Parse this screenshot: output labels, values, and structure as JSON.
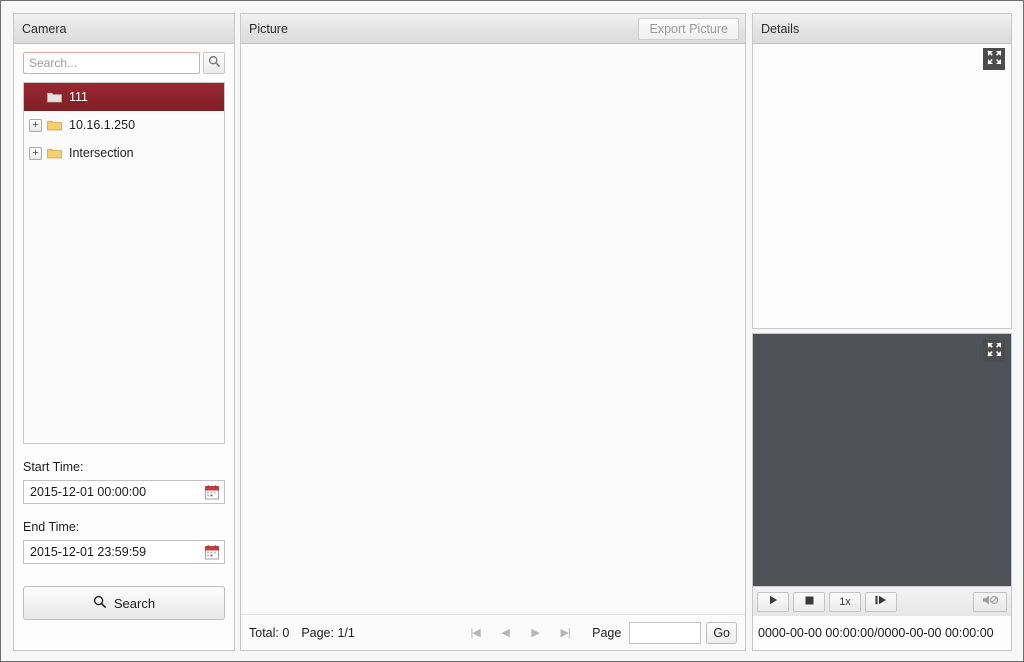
{
  "camera": {
    "title": "Camera",
    "search": {
      "placeholder": "Search...",
      "value": "",
      "icon": "magnifier-icon"
    },
    "tree": [
      {
        "label": "111",
        "selected": true,
        "expandable": false,
        "folder_icon": "folder-icon-white"
      },
      {
        "label": "10.16.1.250",
        "selected": false,
        "expandable": true,
        "toggle": "+",
        "folder_icon": "folder-icon-yellow"
      },
      {
        "label": "Intersection",
        "selected": false,
        "expandable": true,
        "toggle": "+",
        "folder_icon": "folder-icon-yellow"
      }
    ],
    "start_time_label": "Start Time:",
    "start_time_value": "2015-12-01 00:00:00",
    "end_time_label": "End Time:",
    "end_time_value": "2015-12-01 23:59:59",
    "calendar_icon": "calendar-icon",
    "search_button_label": "Search",
    "search_button_icon": "magnifier-icon"
  },
  "picture": {
    "title": "Picture",
    "export_button_label": "Export Picture",
    "pager": {
      "total_label": "Total: 0",
      "page_label": "Page: 1/1",
      "first_icon": "|◀",
      "prev_icon": "◀",
      "next_icon": "▶",
      "last_icon": "▶|",
      "page_field_label": "Page",
      "page_field_value": "",
      "go_label": "Go"
    }
  },
  "details": {
    "title": "Details",
    "expand_icon": "fullscreen-icon"
  },
  "video": {
    "expand_icon": "fullscreen-icon",
    "controls": {
      "play": "▶",
      "stop": "■",
      "speed": "1x",
      "frame_forward": "▐▶",
      "audio": "mute-icon"
    },
    "timestamp": "0000-00-00 00:00:00/0000-00-00 00:00:00"
  },
  "colors": {
    "selection": "#8B2028",
    "video_bg": "#4E5257",
    "panel_header": "#E4E4E4",
    "search_border": "#E6A4A8"
  }
}
